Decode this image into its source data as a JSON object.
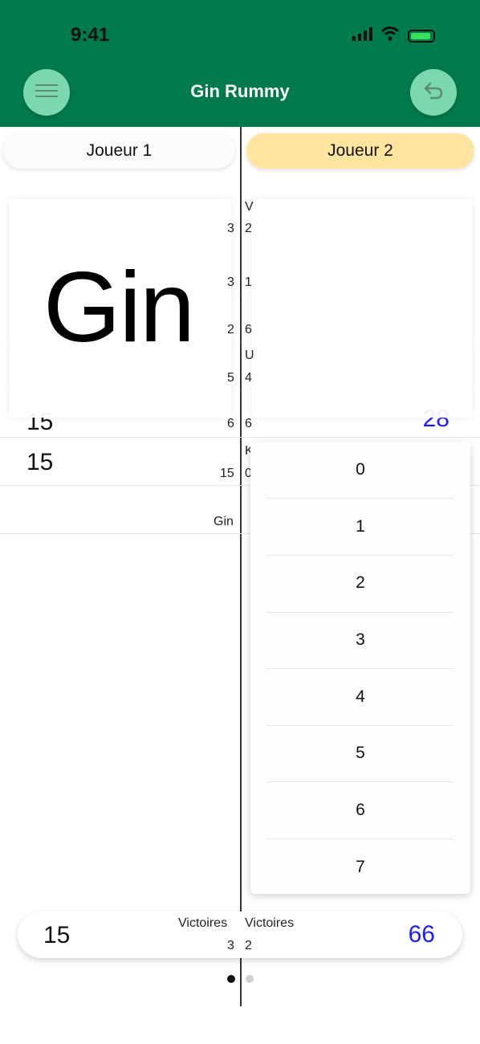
{
  "status": {
    "time": "9:41"
  },
  "nav": {
    "title": "Gin Rummy",
    "menu_icon": "menu-icon",
    "undo_icon": "undo-icon"
  },
  "players": {
    "p1": "Joueur 1",
    "p2": "Joueur 2"
  },
  "table": {
    "rows": [
      {
        "left_score": "15",
        "left_label": "Gin"
      },
      {
        "left_score": "15",
        "left_label": "15"
      }
    ],
    "left_column_values": [
      "3",
      "3",
      "2",
      "5",
      "6",
      "15"
    ],
    "right_column_values": [
      "2",
      "1",
      "6",
      "4",
      "6",
      "0"
    ],
    "right_column_letters": [
      "V",
      "U",
      "K"
    ],
    "right_visible_score": "28",
    "gin_label": "Gin"
  },
  "overlay": {
    "gin_big": "Gin"
  },
  "picker": {
    "options": [
      "0",
      "1",
      "2",
      "3",
      "4",
      "5",
      "6",
      "7"
    ]
  },
  "footer": {
    "left_score": "15",
    "left_label": "Victoires",
    "left_wins": "3",
    "right_label": "Victoires",
    "right_wins": "2",
    "right_score": "66"
  },
  "colors": {
    "header": "#00794b",
    "accent_blue": "#1c1cff",
    "player2_bg": "#ffe59f"
  },
  "pagination": {
    "current": 1,
    "count": 2
  }
}
